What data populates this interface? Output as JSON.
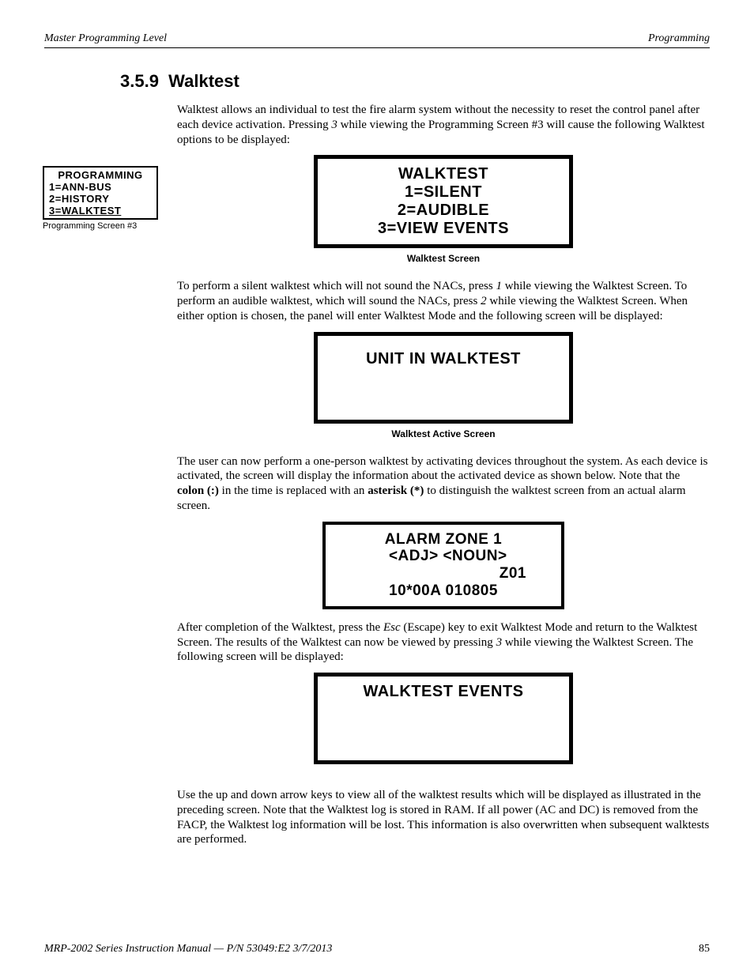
{
  "header": {
    "left": "Master Programming Level",
    "right": "Programming"
  },
  "section": {
    "number": "3.5.9",
    "title": "Walktest"
  },
  "para1": {
    "a": "Walktest allows an individual to test the fire alarm system without the necessity to reset the control panel after each device activation.  Pressing ",
    "key": "3",
    "b": " while viewing the Programming Screen #3 will cause the following Walktest options to be displayed:"
  },
  "sideMenu": {
    "title": "PROGRAMMING",
    "l1": "1=ANN-BUS",
    "l2": "2=HISTORY",
    "l3": "3=WALKTEST",
    "caption": "Programming Screen #3"
  },
  "lcd1": {
    "title": "WALKTEST",
    "l1": "1=SILENT",
    "l2": "2=AUDIBLE",
    "l3": "3=VIEW EVENTS",
    "caption": "Walktest Screen"
  },
  "para2": {
    "a": "To perform a silent walktest which will not sound the NACs, press ",
    "k1": "1",
    "b": " while viewing the Walktest Screen.  To perform an audible walktest, which will sound the NACs, press ",
    "k2": "2",
    "c": " while viewing the Walktest Screen.  When either option is chosen, the panel will enter Walktest Mode and the following screen will be displayed:"
  },
  "lcd2": {
    "l1": "UNIT IN WALKTEST",
    "caption": "Walktest Active Screen"
  },
  "para3": {
    "a": "The user can now perform a one-person walktest by activating devices throughout the system.  As each device is activated, the screen will display the information about the activated device as shown below.  Note that the ",
    "b1": "colon (:)",
    "b": " in the time is replaced with an ",
    "b2": "asterisk (*)",
    "c": " to distinguish the walktest screen from an actual alarm screen."
  },
  "lcd3": {
    "l1": "ALARM ZONE 1",
    "l2": "  <ADJ> <NOUN>",
    "l3": "Z01",
    "l4": "10*00A 010805"
  },
  "para4": {
    "a": "After completion of the Walktest, press the ",
    "k1": "Esc",
    "b": " (Escape) key to exit Walktest Mode and return to the Walktest Screen.  The results of the Walktest can now be viewed by pressing ",
    "k2": "3",
    "c": " while viewing the Walktest Screen.  The following screen will be displayed:"
  },
  "lcd4": {
    "l1": "WALKTEST EVENTS"
  },
  "para5": "Use the up and down arrow keys to view all of the walktest results which will be displayed as illustrated in the preceding screen.  Note that the Walktest log is stored in RAM.  If all power (AC and DC) is removed from the FACP, the Walktest log information will be lost.  This information is also overwritten when subsequent walktests are performed.",
  "footer": {
    "left": "MRP-2002 Series Instruction Manual — P/N 53049:E2  3/7/2013",
    "right": "85"
  }
}
